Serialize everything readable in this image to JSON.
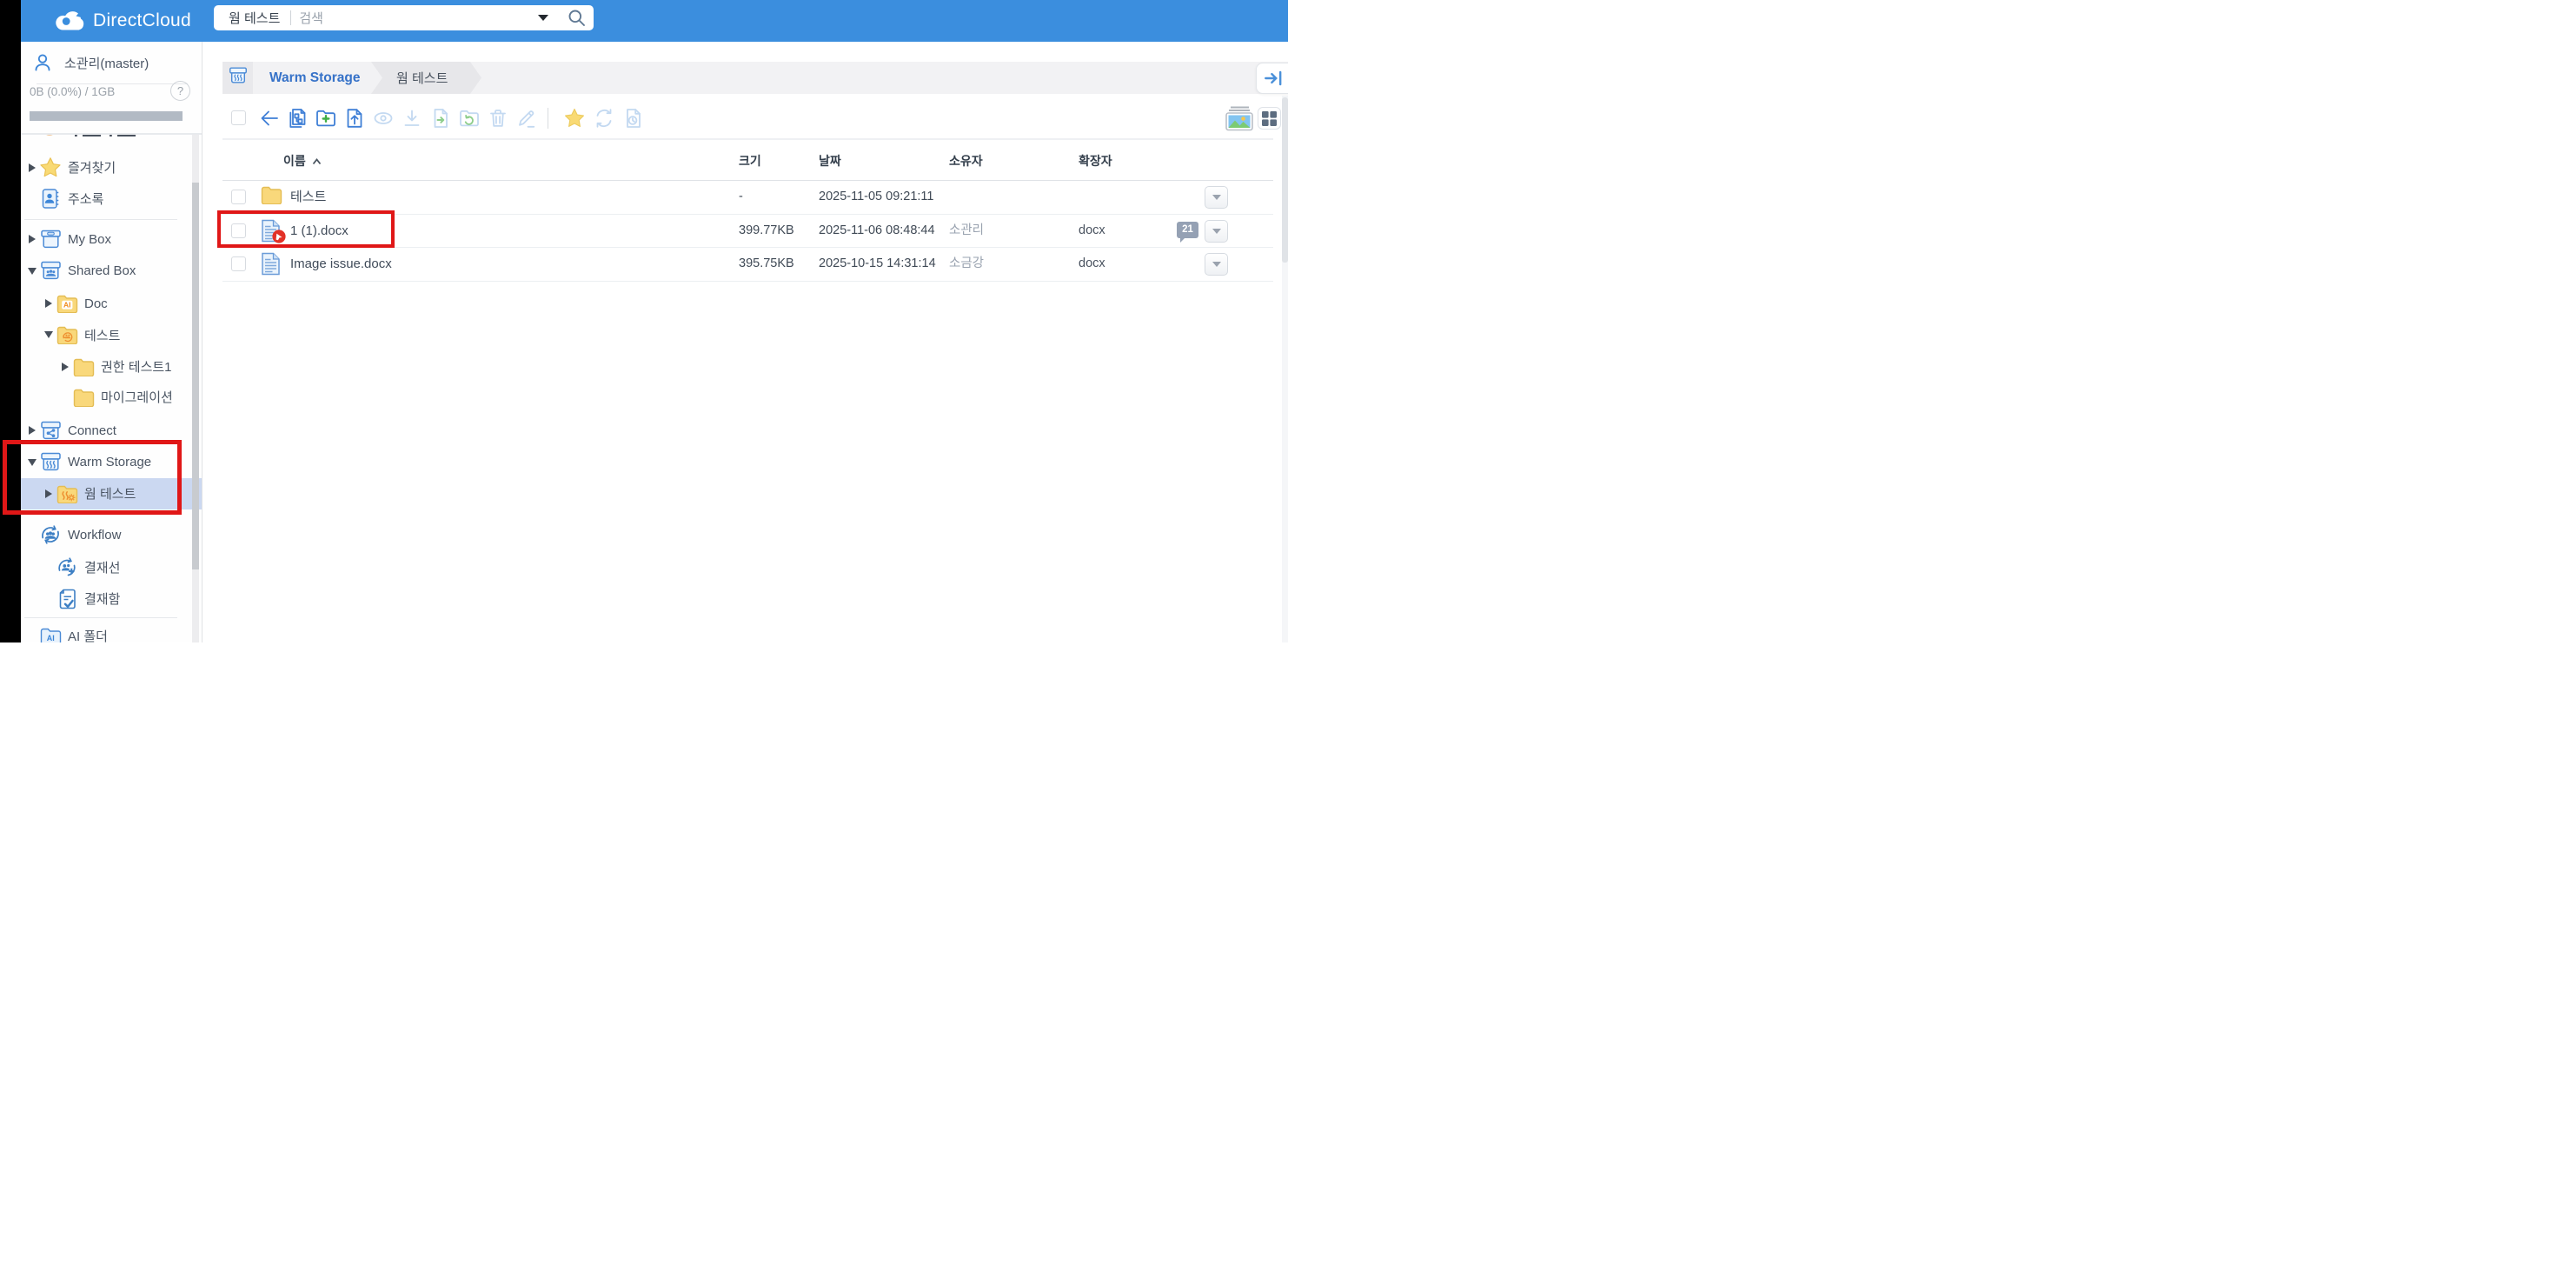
{
  "topbar": {
    "logo": "DirectCloud",
    "search": {
      "scope": "웜 테스트",
      "placeholder": "검색"
    }
  },
  "sidebar": {
    "user_name": "소관리(master)",
    "quota_text": "0B (0.0%) / 1GB",
    "help_label": "?",
    "tree": [
      {
        "label": "",
        "icon": "partial",
        "arrow": "none",
        "depth": 0,
        "partial": true
      },
      {
        "label": "즐겨찾기",
        "icon": "star",
        "arrow": "collapsed",
        "depth": 0
      },
      {
        "label": "주소록",
        "icon": "address-book",
        "arrow": "none",
        "depth": 0
      },
      {
        "label": "My Box",
        "icon": "box-my",
        "arrow": "collapsed",
        "depth": 0
      },
      {
        "label": "Shared Box",
        "icon": "box-shared",
        "arrow": "expanded",
        "depth": 0
      },
      {
        "label": "Doc",
        "icon": "folder-ai",
        "arrow": "collapsed",
        "depth": 1
      },
      {
        "label": "테스트",
        "icon": "folder-share",
        "arrow": "expanded",
        "depth": 1
      },
      {
        "label": "권한 테스트1",
        "icon": "folder",
        "arrow": "collapsed",
        "depth": 2
      },
      {
        "label": "마이그레이션",
        "icon": "folder",
        "arrow": "none",
        "depth": 2
      },
      {
        "label": "Connect",
        "icon": "box-connect",
        "arrow": "collapsed",
        "depth": 0
      },
      {
        "label": "Warm Storage",
        "icon": "box-warm",
        "arrow": "expanded",
        "depth": 0
      },
      {
        "label": "웜 테스트",
        "icon": "folder-warm",
        "arrow": "collapsed",
        "depth": 1,
        "selected": true
      },
      {
        "label": "Workflow",
        "icon": "workflow",
        "arrow": "none",
        "depth": 0
      },
      {
        "label": "결재선",
        "icon": "approval-line",
        "arrow": "none",
        "depth": 1
      },
      {
        "label": "결재함",
        "icon": "approval-box",
        "arrow": "none",
        "depth": 1
      },
      {
        "label": "AI 폴더",
        "icon": "folder-ai-blue",
        "arrow": "none",
        "depth": 0
      }
    ]
  },
  "breadcrumb": {
    "root": "Warm Storage",
    "current": "웜 테스트"
  },
  "toolbar": {
    "items": [
      {
        "icon": "back",
        "enabled": true
      },
      {
        "icon": "organize-copy",
        "enabled": true
      },
      {
        "icon": "new-folder",
        "enabled": true
      },
      {
        "icon": "upload-file",
        "enabled": true
      },
      {
        "icon": "preview-eye",
        "enabled": false
      },
      {
        "icon": "download",
        "enabled": false
      },
      {
        "icon": "move-file",
        "enabled": false
      },
      {
        "icon": "restore-folder",
        "enabled": false
      },
      {
        "icon": "delete-trash",
        "enabled": false
      },
      {
        "icon": "rename-pencil",
        "enabled": false
      },
      {
        "icon": "favorite-star",
        "enabled": true
      },
      {
        "icon": "convert-refresh",
        "enabled": false
      },
      {
        "icon": "version-history",
        "enabled": false
      }
    ],
    "view_controls": [
      {
        "icon": "photo-view"
      },
      {
        "icon": "grid-view"
      }
    ]
  },
  "files": {
    "columns": [
      {
        "key": "name",
        "label": "이름",
        "sorted": "asc"
      },
      {
        "key": "size",
        "label": "크기"
      },
      {
        "key": "date",
        "label": "날짜"
      },
      {
        "key": "owner",
        "label": "소유자"
      },
      {
        "key": "ext",
        "label": "확장자"
      }
    ],
    "rows": [
      {
        "icon": "folder",
        "name": "테스트",
        "size": "-",
        "date": "2025-11-05 09:21:11",
        "owner": "",
        "ext": "",
        "comments": "",
        "locked": false
      },
      {
        "icon": "docx",
        "name": "1 (1).docx",
        "size": "399.77KB",
        "date": "2025-11-06 08:48:44",
        "owner": "소관리",
        "ext": "docx",
        "comments": "21",
        "locked": true,
        "annotated": true
      },
      {
        "icon": "docx",
        "name": "Image issue.docx",
        "size": "395.75KB",
        "date": "2025-10-15 14:31:14",
        "owner": "소금강",
        "ext": "docx",
        "comments": "",
        "locked": false
      }
    ]
  },
  "annotations": {
    "color": "#e01717",
    "boxes": [
      "warm-storage-tree-section",
      "file-row-1-1-docx"
    ]
  }
}
